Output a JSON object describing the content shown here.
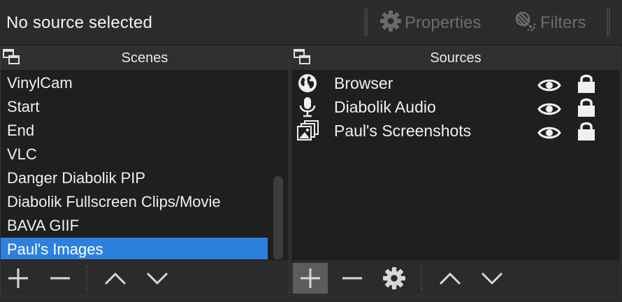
{
  "topbar": {
    "status_text": "No source selected",
    "properties_label": "Properties",
    "filters_label": "Filters",
    "properties_icon": "gear-icon",
    "filters_icon": "filters-icon"
  },
  "scenes": {
    "title": "Scenes",
    "items": [
      {
        "label": "VinylCam",
        "selected": false
      },
      {
        "label": "Start",
        "selected": false
      },
      {
        "label": "End",
        "selected": false
      },
      {
        "label": "VLC",
        "selected": false
      },
      {
        "label": "Danger Diabolik PIP",
        "selected": false
      },
      {
        "label": "Diabolik Fullscreen Clips/Movie",
        "selected": false
      },
      {
        "label": "BAVA GIIF",
        "selected": false
      },
      {
        "label": "Paul's Images",
        "selected": true
      }
    ],
    "toolbar": [
      "add-icon",
      "remove-icon",
      "move-up-icon",
      "move-down-icon"
    ]
  },
  "sources": {
    "title": "Sources",
    "items": [
      {
        "label": "Browser",
        "icon": "globe-icon",
        "visible": true,
        "locked": true
      },
      {
        "label": "Diabolik Audio",
        "icon": "microphone-icon",
        "visible": true,
        "locked": true
      },
      {
        "label": "Paul's Screenshots",
        "icon": "image-slideshow-icon",
        "visible": true,
        "locked": true
      }
    ],
    "toolbar": [
      "add-icon",
      "remove-icon",
      "gear-icon",
      "move-up-icon",
      "move-down-icon"
    ]
  },
  "colors": {
    "selection": "#2e80df",
    "panel_bg": "#1f1f1f",
    "window_bg": "#2b2b2b"
  }
}
